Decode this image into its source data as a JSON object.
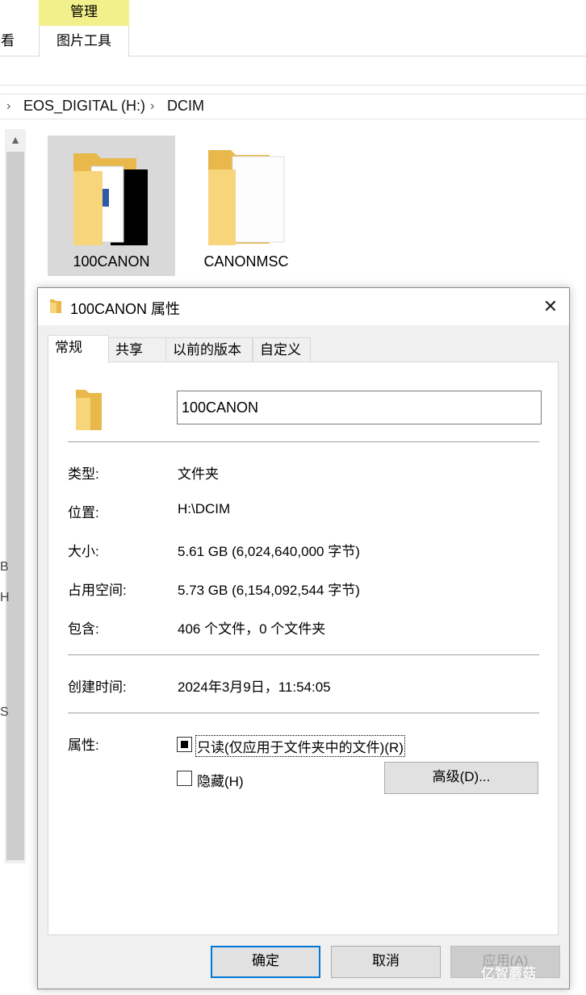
{
  "ribbon": {
    "manage_label": "管理",
    "view_label_partial": "查看",
    "picture_tools_label": "图片工具"
  },
  "address": {
    "segments": [
      "EOS_DIGITAL (H:)",
      "DCIM"
    ]
  },
  "items": [
    {
      "name": "100CANON",
      "selected": true
    },
    {
      "name": "CANONMSC",
      "selected": false
    }
  ],
  "edge_glyphs": [
    "B",
    "H",
    "S"
  ],
  "dialog": {
    "title": "100CANON 属性",
    "tabs": [
      "常规",
      "共享",
      "以前的版本",
      "自定义"
    ],
    "active_tab": "常规",
    "name_value": "100CANON",
    "rows": [
      {
        "label": "类型:",
        "value": "文件夹"
      },
      {
        "label": "位置:",
        "value": "H:\\DCIM"
      },
      {
        "label": "大小:",
        "value": "5.61 GB (6,024,640,000 字节)"
      },
      {
        "label": "占用空间:",
        "value": "5.73 GB (6,154,092,544 字节)"
      },
      {
        "label": "包含:",
        "value": "406 个文件，0 个文件夹"
      }
    ],
    "created_label": "创建时间:",
    "created_value": "2024年3月9日，11:54:05",
    "attributes_label": "属性:",
    "readonly_label": "只读(仅应用于文件夹中的文件)(R)",
    "readonly_state": "indeterminate",
    "hidden_label": "隐藏(H)",
    "hidden_state": "unchecked",
    "advanced_button": "高级(D)...",
    "ok_button": "确定",
    "cancel_button": "取消",
    "apply_button": "应用(A)"
  },
  "watermark": "亿智蘑菇",
  "colors": {
    "manage_tab_bg": "#f2f08a",
    "selected_item_bg": "#d9d9d9",
    "dialog_bg": "#f0f0f0",
    "default_button_border": "#0078d7",
    "folder_yellow": "#f5c95c"
  }
}
